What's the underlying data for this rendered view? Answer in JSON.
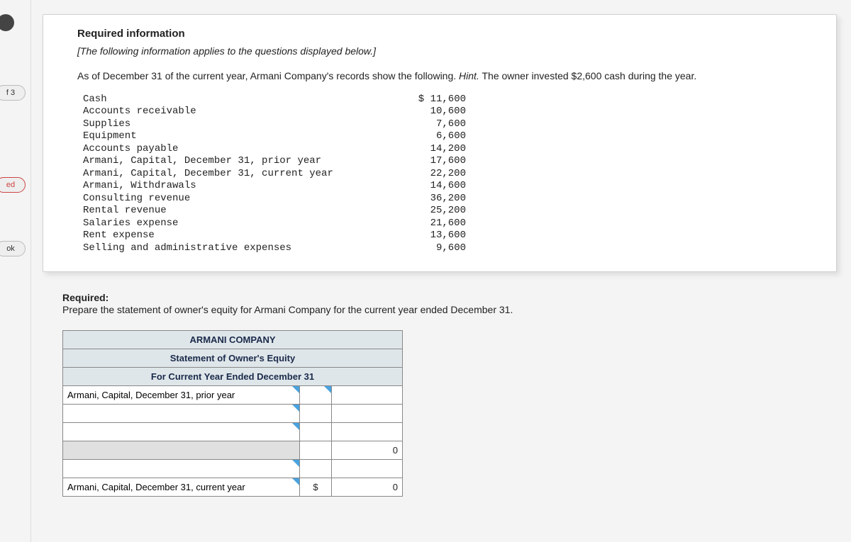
{
  "nav": {
    "chip1": "f 3",
    "chip2": "ed",
    "chip3": "ok"
  },
  "card": {
    "title": "Required information",
    "note": "[The following information applies to the questions displayed below.]",
    "paragraph_prefix": "As of December 31 of the current year, Armani Company's records show the following. ",
    "hint_label": "Hint.",
    "paragraph_suffix": " The owner invested $2,600 cash during the year.",
    "records": [
      {
        "label": "Cash",
        "value": "$ 11,600"
      },
      {
        "label": "Accounts receivable",
        "value": "10,600"
      },
      {
        "label": "Supplies",
        "value": "7,600"
      },
      {
        "label": "Equipment",
        "value": "6,600"
      },
      {
        "label": "Accounts payable",
        "value": "14,200"
      },
      {
        "label": "Armani, Capital, December 31, prior year",
        "value": "17,600"
      },
      {
        "label": "Armani, Capital, December 31, current year",
        "value": "22,200"
      },
      {
        "label": "Armani, Withdrawals",
        "value": "14,600"
      },
      {
        "label": "Consulting revenue",
        "value": "36,200"
      },
      {
        "label": "Rental revenue",
        "value": "25,200"
      },
      {
        "label": "Salaries expense",
        "value": "21,600"
      },
      {
        "label": "Rent expense",
        "value": "13,600"
      },
      {
        "label": "Selling and administrative expenses",
        "value": "9,600"
      }
    ]
  },
  "required": {
    "heading": "Required:",
    "text": "Prepare the statement of owner's equity for Armani Company for the current year ended December 31."
  },
  "statement": {
    "header_company": "ARMANI COMPANY",
    "header_title": "Statement of Owner's Equity",
    "header_period": "For Current Year Ended December 31",
    "row1_label": "Armani, Capital, December 31, prior year",
    "row1_amount": "",
    "row2_label": "",
    "row2_amount": "",
    "row3_label": "",
    "row3_amount": "",
    "subtotal_amount": "0",
    "row5_label": "",
    "row5_amount": "",
    "final_label": "Armani, Capital, December 31, current year",
    "final_currency": "$",
    "final_amount": "0"
  }
}
